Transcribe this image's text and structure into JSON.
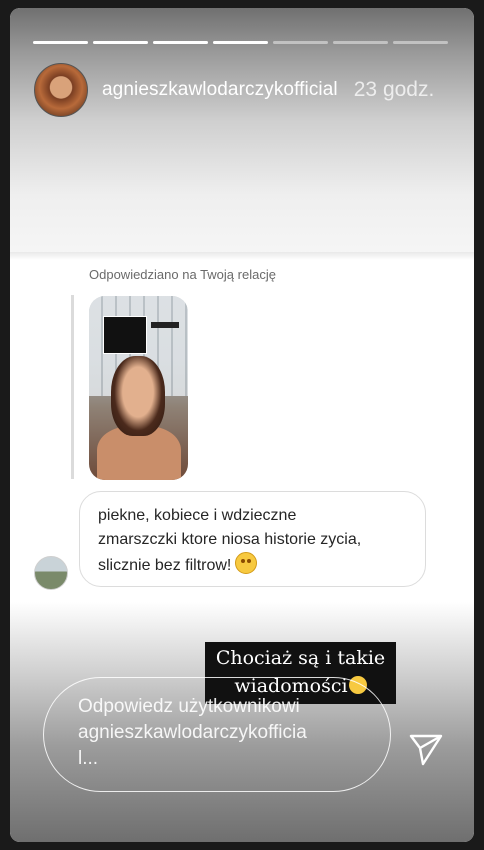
{
  "story": {
    "progress_total": 7,
    "progress_done": 4,
    "username": "agnieszkawlodarczykofficial",
    "time": "23 godz.",
    "reply_caption": "Odpowiedziano na Twoją relację",
    "message_line1": "piekne, kobiece i wdzieczne",
    "message_line2": "zmarszczki ktore niosa historie zycia,",
    "message_line3": "slicznie bez filtrow!",
    "emoji": "star-struck-emoji",
    "caption_line1": "Chociaż są i takie",
    "caption_line2": "wiadomości",
    "reply_placeholder": "Odpowiedz użytkownikowi\nagnieszkawlodarczykofficia\nl...",
    "send_icon": "send-icon"
  }
}
